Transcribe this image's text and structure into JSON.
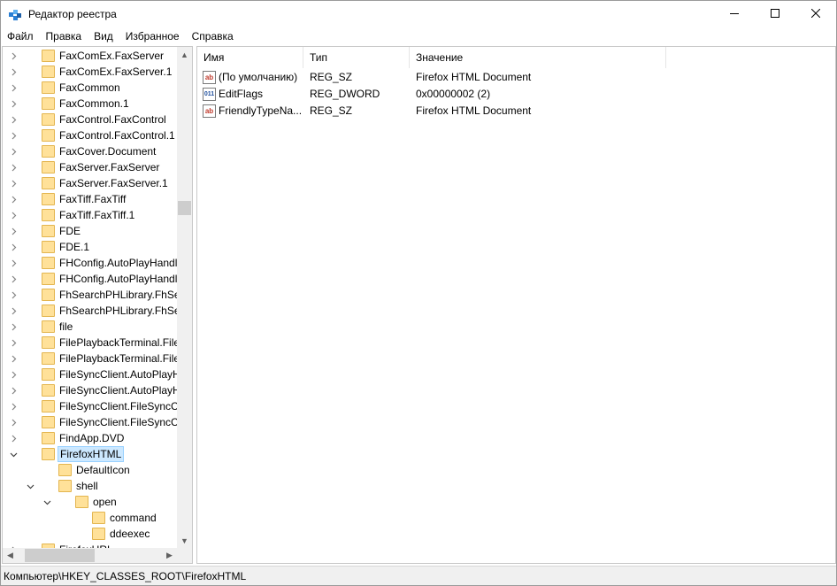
{
  "window": {
    "title": "Редактор реестра",
    "minimize_icon": "minimize-icon",
    "maximize_icon": "maximize-icon",
    "close_icon": "close-icon"
  },
  "menu": [
    "Файл",
    "Правка",
    "Вид",
    "Избранное",
    "Справка"
  ],
  "tree": {
    "items": [
      {
        "label": "FaxComEx.FaxServer"
      },
      {
        "label": "FaxComEx.FaxServer.1"
      },
      {
        "label": "FaxCommon"
      },
      {
        "label": "FaxCommon.1"
      },
      {
        "label": "FaxControl.FaxControl"
      },
      {
        "label": "FaxControl.FaxControl.1"
      },
      {
        "label": "FaxCover.Document"
      },
      {
        "label": "FaxServer.FaxServer"
      },
      {
        "label": "FaxServer.FaxServer.1"
      },
      {
        "label": "FaxTiff.FaxTiff"
      },
      {
        "label": "FaxTiff.FaxTiff.1"
      },
      {
        "label": "FDE"
      },
      {
        "label": "FDE.1"
      },
      {
        "label": "FHConfig.AutoPlayHandl"
      },
      {
        "label": "FHConfig.AutoPlayHandl"
      },
      {
        "label": "FhSearchPHLibrary.FhSea"
      },
      {
        "label": "FhSearchPHLibrary.FhSea"
      },
      {
        "label": "file"
      },
      {
        "label": "FilePlaybackTerminal.File"
      },
      {
        "label": "FilePlaybackTerminal.File"
      },
      {
        "label": "FileSyncClient.AutoPlayH"
      },
      {
        "label": "FileSyncClient.AutoPlayH"
      },
      {
        "label": "FileSyncClient.FileSyncCli"
      },
      {
        "label": "FileSyncClient.FileSyncCli"
      },
      {
        "label": "FindApp.DVD"
      },
      {
        "label": "FirefoxHTML"
      },
      {
        "label": "DefaultIcon"
      },
      {
        "label": "shell"
      },
      {
        "label": "open"
      },
      {
        "label": "command"
      },
      {
        "label": "ddeexec"
      },
      {
        "label": "FirefoxURL"
      }
    ]
  },
  "list": {
    "headers": [
      "Имя",
      "Тип",
      "Значение"
    ],
    "rows": [
      {
        "icon": "ab",
        "name": "(По умолчанию)",
        "type": "REG_SZ",
        "value": "Firefox HTML Document"
      },
      {
        "icon": "011",
        "name": "EditFlags",
        "type": "REG_DWORD",
        "value": "0x00000002 (2)"
      },
      {
        "icon": "ab",
        "name": "FriendlyTypeNa...",
        "type": "REG_SZ",
        "value": "Firefox HTML Document"
      }
    ]
  },
  "status": {
    "path": "Компьютер\\HKEY_CLASSES_ROOT\\FirefoxHTML"
  }
}
